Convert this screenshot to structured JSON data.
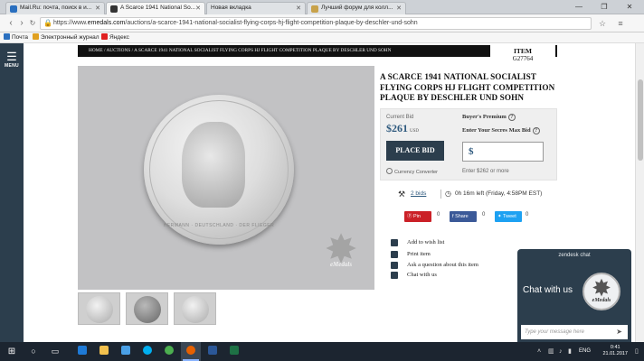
{
  "browser": {
    "tabs": [
      {
        "title": "Mail.Ru: почта, поиск в и...",
        "favicon_color": "#2a6fbf",
        "active": false
      },
      {
        "title": "A Scarce 1941 National So...",
        "favicon_color": "#333333",
        "active": true
      },
      {
        "title": "Новая вкладка",
        "favicon_color": "#cfd2d6",
        "active": false
      },
      {
        "title": "Лучший форум для колл...",
        "favicon_color": "#c8a24a",
        "active": false
      }
    ],
    "url_scheme": "https://www.",
    "url_domain": "emedals.com",
    "url_path": "/auctions/a-scarce-1941-national-socialist-flying-corps-hj-flight-competition-plaque-by-deschler-und-sohn",
    "bookmarks": [
      {
        "label": "Почта",
        "color": "#2a6fbf"
      },
      {
        "label": "Электронный журнал",
        "color": "#e0a020"
      },
      {
        "label": "Яндекс",
        "color": "#e02020"
      }
    ]
  },
  "nav": {
    "menu_label": "MENU"
  },
  "breadcrumb": {
    "home": "HOME",
    "auctions": "AUCTIONS",
    "current": "A SCARCE 1941 NATIONAL SOCIALIST FLYING CORPS HJ FLIGHT COMPETITION PLAQUE BY DESCHLER UND SOHN",
    "sep": "/"
  },
  "item": {
    "label": "ITEM",
    "number": "G27764"
  },
  "product": {
    "title": "A SCARCE 1941 NATIONAL SOCIALIST FLYING CORPS HJ FLIGHT COMPETITION PLAQUE BY DESCHLER UND SOHN",
    "coin_legend": "HERMANN · DEUTSCHLAND · DER FLIEGER",
    "watermark": "eMedals"
  },
  "bid": {
    "current_bid_label": "Current Bid",
    "current_bid": "$261",
    "currency": "USD",
    "buyers_premium": "Buyer's Premium",
    "secret_max_label": "Enter Your Secres Max Bid",
    "place_bid": "PLACE BID",
    "dollar": "$",
    "currency_converter": "Currency Converter",
    "enter_or_more": "Enter $262 or more",
    "bids_link": "2 bids",
    "time_left": "0h 16m left (Friday, 4:58PM EST)"
  },
  "share": {
    "pin": "Pin",
    "pin_count": "0",
    "share": "Share",
    "share_count": "0",
    "tweet": "Tweet",
    "tweet_count": "0"
  },
  "actions": [
    {
      "label": "Add to wish list",
      "icon": "heart-icon"
    },
    {
      "label": "Print item",
      "icon": "print-icon"
    },
    {
      "label": "Ask a question about this item",
      "icon": "question-icon"
    },
    {
      "label": "Chat with us",
      "icon": "chat-icon"
    }
  ],
  "zendesk": {
    "header": "zendesk chat",
    "chat_label": "Chat with us",
    "badge": "eMedals",
    "placeholder": "Type your message here"
  },
  "taskbar": {
    "lang": "ENG",
    "time": "0:41",
    "date": "21.01.2017"
  }
}
